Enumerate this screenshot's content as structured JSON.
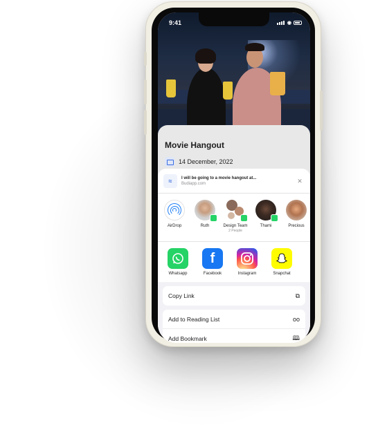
{
  "status_bar": {
    "time": "9:41"
  },
  "event": {
    "title": "Movie Hangout",
    "date": "14 December, 2022"
  },
  "share_sheet": {
    "header": {
      "title": "I will be going to a movie hangout at...",
      "subtitle": "Budiapp.com"
    },
    "people": [
      {
        "name": "AirDrop",
        "sub": ""
      },
      {
        "name": "Ruth",
        "sub": ""
      },
      {
        "name": "Design Team",
        "sub": "2 People"
      },
      {
        "name": "Thami",
        "sub": ""
      },
      {
        "name": "Precious",
        "sub": ""
      }
    ],
    "apps": [
      {
        "name": "Whatsapp",
        "icon": "whatsapp-icon"
      },
      {
        "name": "Facebook",
        "icon": "facebook-icon"
      },
      {
        "name": "Instagram",
        "icon": "instagram-icon"
      },
      {
        "name": "Snapchat",
        "icon": "snapchat-icon"
      }
    ],
    "actions": [
      {
        "label": "Copy Link",
        "icon": "copy-icon"
      },
      {
        "label": "Add to Reading List",
        "icon": "glasses-icon"
      },
      {
        "label": "Add Bookmark",
        "icon": "book-icon"
      }
    ]
  },
  "colors": {
    "accent": "#1a7cf5",
    "whatsapp": "#25d366",
    "facebook": "#1877f2",
    "snapchat": "#fffc00",
    "phone_body": "#f1eee4"
  }
}
